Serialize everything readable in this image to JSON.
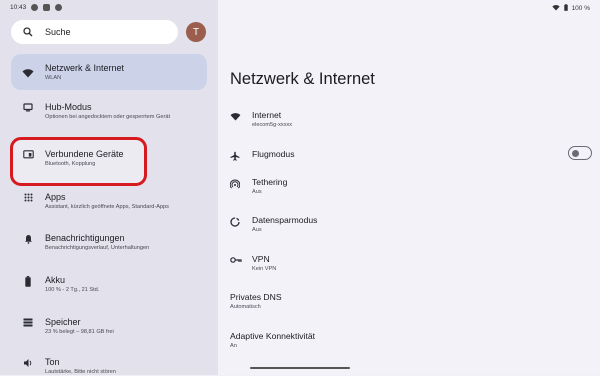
{
  "status_bar": {
    "time": "10:43",
    "battery": "100 %"
  },
  "search": {
    "label": "Suche"
  },
  "avatar": {
    "initial": "T"
  },
  "sidebar": {
    "items": [
      {
        "title": "Netzwerk & Internet",
        "sub": "WLAN",
        "icon": "wifi-icon"
      },
      {
        "title": "Hub-Modus",
        "sub": "Optionen bei angedocktem oder gesperrtem Gerät",
        "icon": "dock-icon"
      },
      {
        "title": "Verbundene Geräte",
        "sub": "Bluetooth, Kopplung",
        "icon": "devices-icon"
      },
      {
        "title": "Apps",
        "sub": "Assistant, kürzlich geöffnete Apps, Standard-Apps",
        "icon": "apps-grid-icon"
      },
      {
        "title": "Benachrichtigungen",
        "sub": "Benachrichtigungsverlauf, Unterhaltungen",
        "icon": "bell-icon"
      },
      {
        "title": "Akku",
        "sub": "100 % - 2 Tg., 21 Std.",
        "icon": "battery-icon"
      },
      {
        "title": "Speicher",
        "sub": "23 % belegt – 98,81 GB frei",
        "icon": "storage-icon"
      },
      {
        "title": "Ton",
        "sub": "Lautstärke, Bitte nicht stören",
        "icon": "speaker-icon"
      }
    ]
  },
  "main": {
    "title": "Netzwerk & Internet",
    "rows": [
      {
        "title": "Internet",
        "sub": "elecom5g-xxxxx",
        "icon": "wifi-icon"
      },
      {
        "title": "Flugmodus",
        "sub": "",
        "icon": "airplane-icon",
        "toggle": false
      },
      {
        "title": "Tethering",
        "sub": "Aus",
        "icon": "hotspot-icon"
      },
      {
        "title": "Datensparmodus",
        "sub": "Aus",
        "icon": "data-saver-icon"
      },
      {
        "title": "VPN",
        "sub": "Kein VPN",
        "icon": "vpn-key-icon"
      },
      {
        "title": "Privates DNS",
        "sub": "Automatisch"
      },
      {
        "title": "Adaptive Konnektivität",
        "sub": "An"
      }
    ]
  },
  "colors": {
    "highlight": "#d71920",
    "selected": "#ccd3e9",
    "sidebar_bg": "#e2e1ec"
  }
}
